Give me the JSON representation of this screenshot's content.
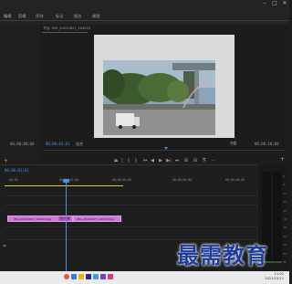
{
  "app": {
    "menu": [
      {
        "id": "m1",
        "label": "编辑"
      },
      {
        "id": "m2",
        "label": "剪辑"
      },
      {
        "id": "m3",
        "label": "序列"
      },
      {
        "id": "m4",
        "label": "标记"
      },
      {
        "id": "m5",
        "label": "图形"
      },
      {
        "id": "m6",
        "label": "视图"
      }
    ],
    "window_controls": {
      "minimize": "–",
      "maximize": "□",
      "close": "✕"
    }
  },
  "program_panel": {
    "tab_label": "节目: IMG_20220827_164520",
    "timecode_current": "00;00;01;01",
    "fit_label": "适合",
    "zoom_menu": "完整",
    "timecode_duration": "00;00;10;00"
  },
  "left_panel": {
    "timecode": "00;00;00;00"
  },
  "transport": [
    "⏏",
    "|",
    "{",
    "}",
    "⏮",
    "◀",
    "▶",
    "▶|",
    "⏭",
    "⊞",
    "⊟",
    "⎘",
    "⋯"
  ],
  "timeline": {
    "timecode": "00;00;01;01",
    "ruler": [
      {
        "id": "r0",
        "label": "00;00"
      },
      {
        "id": "r1",
        "label": "00;00;02;00"
      },
      {
        "id": "r2",
        "label": "00;00;04;00"
      },
      {
        "id": "r3",
        "label": "00;00;06;00"
      },
      {
        "id": "r4",
        "label": "00;00;08;00"
      }
    ],
    "clips": [
      {
        "id": "c1",
        "label": "IMG_20220827_164520.jpg"
      },
      {
        "id": "c2",
        "label": "IMG_20220827_164532.jpg"
      }
    ],
    "transition_label": "交叉溶解"
  },
  "meter_labels": [
    "0",
    "-6",
    "-12",
    "-18",
    "-24",
    "-30",
    "-36",
    "-42",
    "-48",
    "-54",
    "dB"
  ],
  "taskbar": {
    "time": "11:02",
    "date": "2021/10/11"
  },
  "watermark": "最需教育",
  "colors": {
    "accent_blue": "#4a8fe8",
    "clip_pink": "#d07ad6",
    "playhead_yellow": "#d6c63a"
  }
}
